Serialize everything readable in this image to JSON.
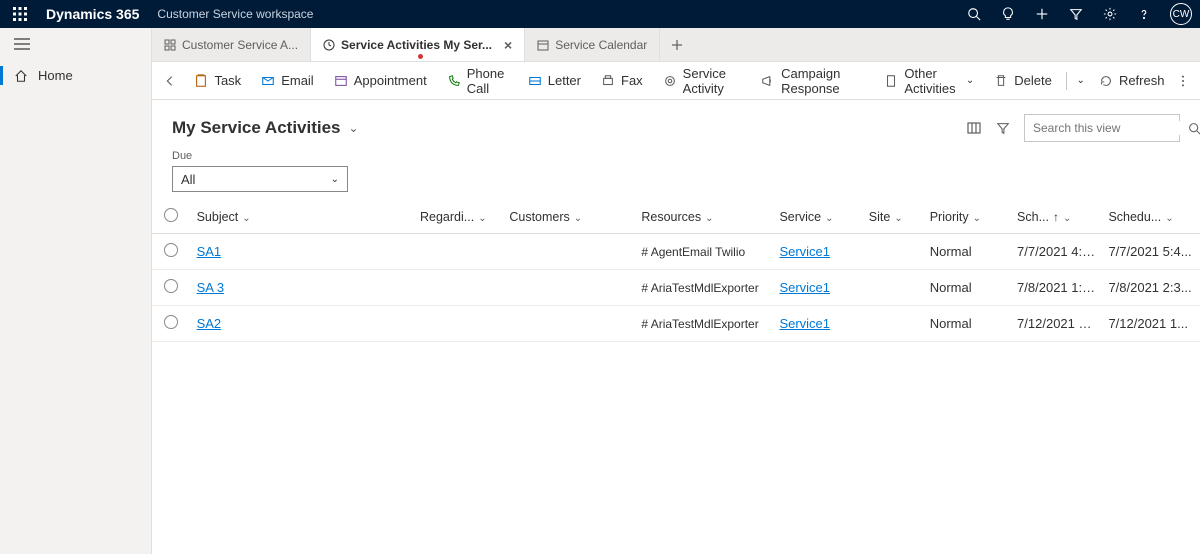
{
  "topbar": {
    "brand": "Dynamics 365",
    "workspace": "Customer Service workspace",
    "avatar_initials": "CW"
  },
  "nav": {
    "home": "Home"
  },
  "tabs": [
    {
      "label": "Customer Service A...",
      "active": false
    },
    {
      "label": "Service Activities My Ser...",
      "active": true
    },
    {
      "label": "Service Calendar",
      "active": false
    }
  ],
  "commands": {
    "task": "Task",
    "email": "Email",
    "appointment": "Appointment",
    "phone_call": "Phone Call",
    "letter": "Letter",
    "fax": "Fax",
    "service_activity": "Service Activity",
    "campaign_response": "Campaign Response",
    "other_activities": "Other Activities",
    "delete": "Delete",
    "refresh": "Refresh"
  },
  "view": {
    "title": "My Service Activities",
    "search_placeholder": "Search this view"
  },
  "filter": {
    "label": "Due",
    "value": "All"
  },
  "columns": {
    "subject": "Subject",
    "regarding": "Regardi...",
    "customers": "Customers",
    "resources": "Resources",
    "service": "Service",
    "site": "Site",
    "priority": "Priority",
    "sched_start": "Sch...",
    "sched_end": "Schedu..."
  },
  "rows": [
    {
      "subject": "SA1",
      "resources": "AgentEmail Twilio",
      "service": "Service1",
      "priority": "Normal",
      "sched_start": "7/7/2021 4:4...",
      "sched_end": "7/7/2021 5:4..."
    },
    {
      "subject": "SA 3",
      "resources": "AriaTestMdlExporter",
      "service": "Service1",
      "priority": "Normal",
      "sched_start": "7/8/2021 1:3...",
      "sched_end": "7/8/2021 2:3..."
    },
    {
      "subject": "SA2",
      "resources": "AriaTestMdlExporter",
      "service": "Service1",
      "priority": "Normal",
      "sched_start": "7/12/2021 1...",
      "sched_end": "7/12/2021 1..."
    }
  ]
}
